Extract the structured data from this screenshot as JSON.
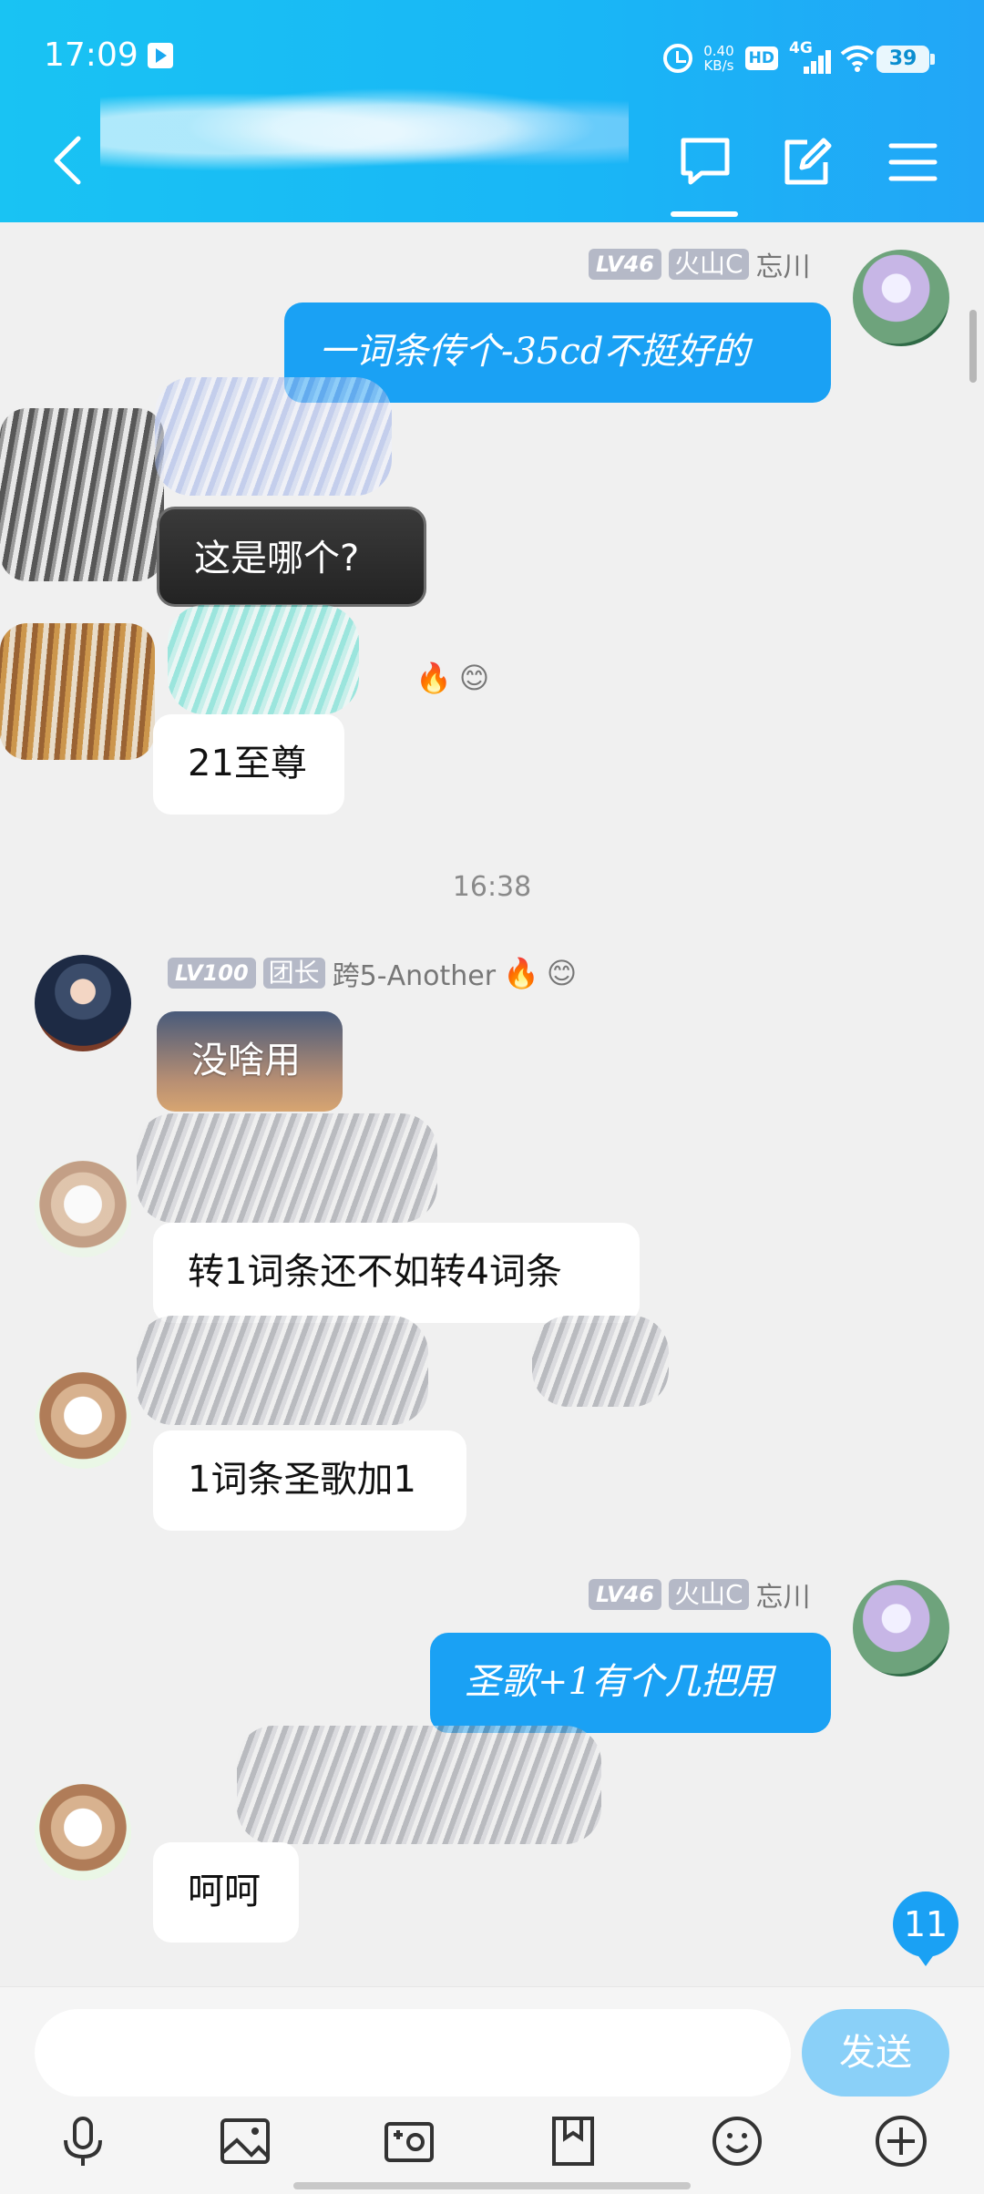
{
  "status_bar": {
    "time": "17:09",
    "net_speed_value": "0.40",
    "net_speed_unit": "KB/s",
    "hd_label": "HD",
    "network_label": "4G",
    "battery": "39"
  },
  "nav": {
    "back_icon": "chevron-left-icon",
    "tabs": [
      "chat-bubble-icon",
      "edit-icon",
      "menu-icon"
    ],
    "active_tab": "chat-bubble-icon"
  },
  "messages": [
    {
      "sender": "self",
      "level": "LV46",
      "title": "火山C",
      "name": "忘川",
      "text": "一词条传个-35cd不挺好的"
    },
    {
      "sender": "other",
      "text": "这是哪个?"
    },
    {
      "sender": "other",
      "text": "21至尊"
    },
    {
      "sender": "other",
      "level": "LV100",
      "title": "团长",
      "name": "跨5-Another",
      "text": "没啥用"
    },
    {
      "sender": "other",
      "text": "转1词条还不如转4词条"
    },
    {
      "sender": "other",
      "text": "1词条圣歌加1"
    },
    {
      "sender": "self",
      "level": "LV46",
      "title": "火山C",
      "name": "忘川",
      "text": "圣歌+1有个几把用"
    },
    {
      "sender": "other",
      "text": "呵呵"
    }
  ],
  "timestamp": "16:38",
  "unread_count": "11",
  "composer": {
    "send_label": "发送",
    "placeholder": ""
  },
  "toolbar": [
    "microphone-icon",
    "image-icon",
    "camera-icon",
    "file-icon",
    "emoji-icon",
    "plus-icon"
  ],
  "colors": {
    "header": "#19b6f6",
    "self_bubble": "#1aa1f4",
    "send_button": "#8ad0f8",
    "background": "#f0f0f0"
  }
}
